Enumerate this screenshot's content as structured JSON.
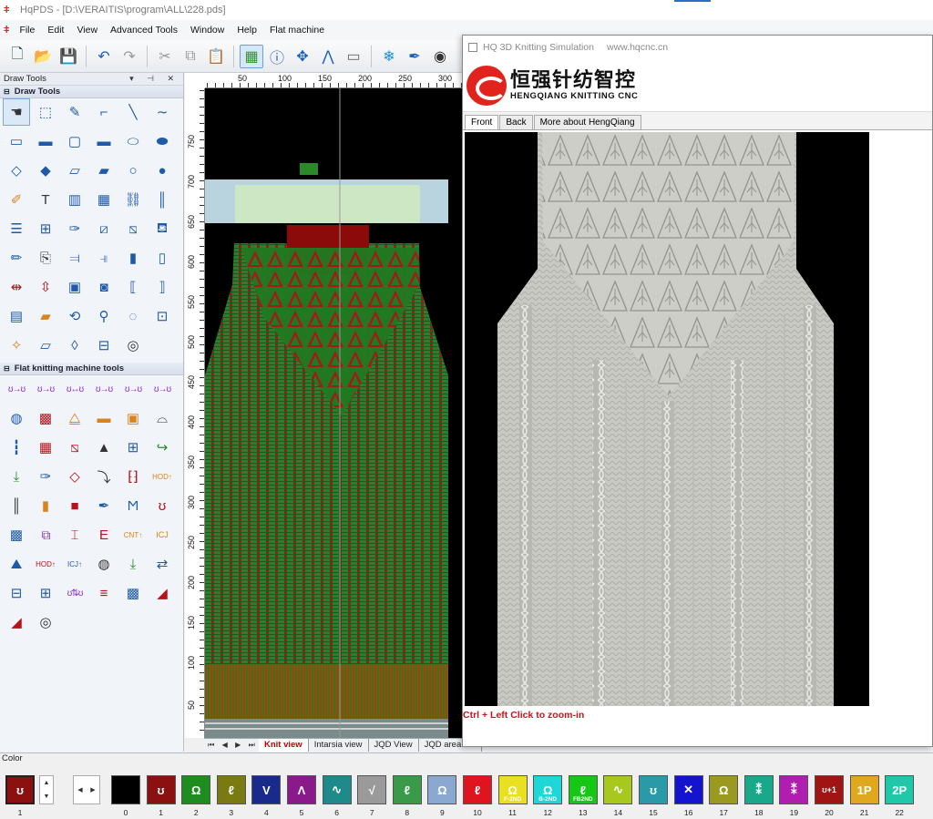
{
  "window": {
    "title": "HqPDS - [D:\\VERAITIS\\program\\ALL\\228.pds]"
  },
  "menu": [
    "File",
    "Edit",
    "View",
    "Advanced Tools",
    "Window",
    "Help",
    "Flat machine"
  ],
  "toolbar_icons": [
    "new-file",
    "open-folder",
    "save",
    "undo",
    "redo",
    "cut",
    "copy",
    "paste",
    "grid",
    "info",
    "move",
    "path",
    "rect-select",
    "snowflake",
    "pen",
    "camera"
  ],
  "left_panel": {
    "title": "Draw Tools",
    "group1": "Draw Tools",
    "group2": "Flat knitting machine tools"
  },
  "rulers": {
    "top": [
      "50",
      "100",
      "150",
      "200",
      "250",
      "300"
    ],
    "left": [
      "750",
      "700",
      "650",
      "600",
      "550",
      "500",
      "450",
      "400",
      "350",
      "300",
      "250",
      "200",
      "150",
      "100",
      "50"
    ]
  },
  "bottom_tabs": [
    "Knit view",
    "Intarsia view",
    "JQD View",
    "JQD area ma"
  ],
  "sim": {
    "title": "HQ 3D Knitting Simulation",
    "url": "www.hqcnc.cn",
    "brand_cn": "恒强针纺智控",
    "brand_en": "HENGQIANG KNITTING CNC",
    "tabs": [
      "Front",
      "Back",
      "More about HengQiang"
    ],
    "hint": "Ctrl + Left Click to zoom-in"
  },
  "color_panel": {
    "label": "Color",
    "current_number": "1",
    "swatches": [
      {
        "n": "0",
        "color": "#000000",
        "glyph": ""
      },
      {
        "n": "1",
        "color": "#8b1010",
        "glyph": "ʊ"
      },
      {
        "n": "2",
        "color": "#1e8c1e",
        "glyph": "Ω"
      },
      {
        "n": "3",
        "color": "#7a7a12",
        "glyph": "ℓ"
      },
      {
        "n": "4",
        "color": "#1a2a8c",
        "glyph": "V"
      },
      {
        "n": "5",
        "color": "#8a1a8a",
        "glyph": "Λ"
      },
      {
        "n": "6",
        "color": "#1f8a8a",
        "glyph": "∿"
      },
      {
        "n": "7",
        "color": "#9a9a9a",
        "glyph": "√"
      },
      {
        "n": "8",
        "color": "#3a9a4a",
        "glyph": "ℓ"
      },
      {
        "n": "9",
        "color": "#8aa8d0",
        "glyph": "Ω"
      },
      {
        "n": "10",
        "color": "#e0141e",
        "glyph": "ℓ"
      },
      {
        "n": "11",
        "color": "#e8e020",
        "glyph": "Ω",
        "sub": "F-2ND"
      },
      {
        "n": "12",
        "color": "#1ed8d8",
        "glyph": "Ω",
        "sub": "B-2ND"
      },
      {
        "n": "13",
        "color": "#14c814",
        "glyph": "ℓ",
        "sub": "FB2ND"
      },
      {
        "n": "14",
        "color": "#a8c81e",
        "glyph": "∿"
      },
      {
        "n": "15",
        "color": "#2a9aa8",
        "glyph": "ʊ"
      },
      {
        "n": "16",
        "color": "#1414d0",
        "glyph": "✕"
      },
      {
        "n": "17",
        "color": "#9a9a20",
        "glyph": "Ω"
      },
      {
        "n": "18",
        "color": "#1aa88a",
        "glyph": "⁑"
      },
      {
        "n": "19",
        "color": "#b01eb0",
        "glyph": "⁑"
      },
      {
        "n": "20",
        "color": "#a01414",
        "glyph": "ʊ+1"
      },
      {
        "n": "21",
        "color": "#e0a81e",
        "glyph": "1P"
      },
      {
        "n": "22",
        "color": "#1ec8a8",
        "glyph": "2P"
      }
    ]
  }
}
